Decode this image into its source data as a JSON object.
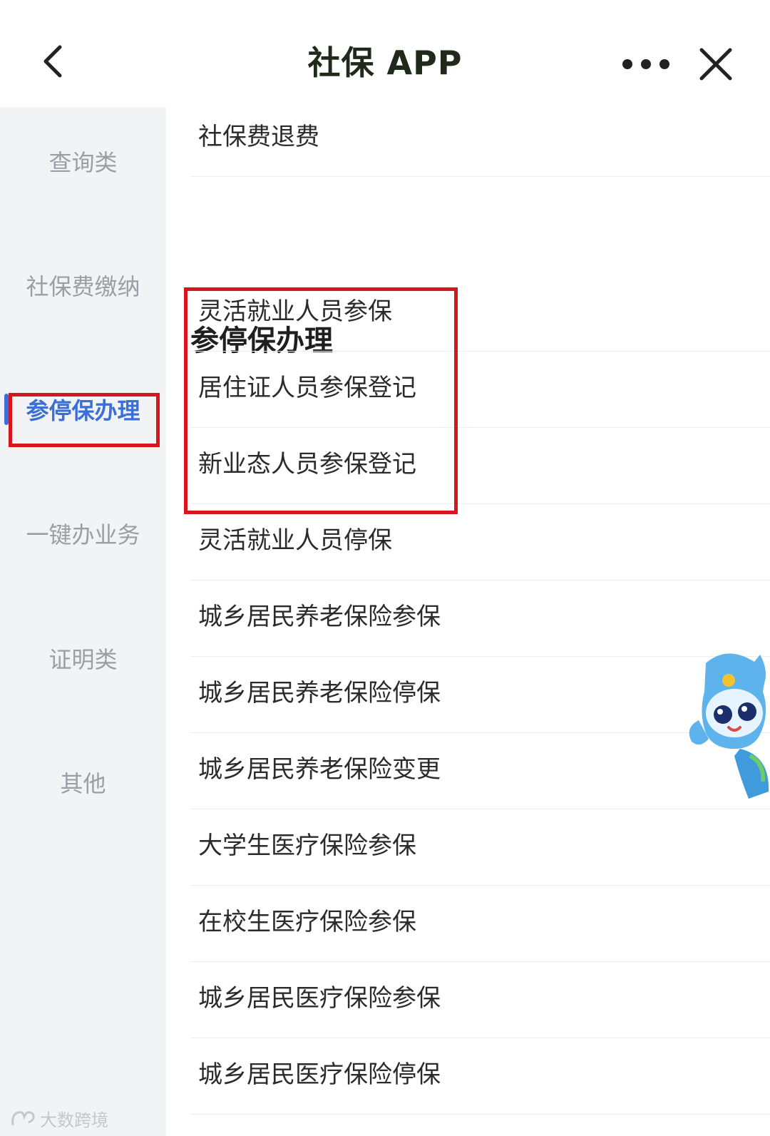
{
  "header": {
    "title": "社保 APP",
    "back_icon": "chevron-left-icon",
    "more_icon": "more-dots-icon",
    "close_icon": "close-icon"
  },
  "sidebar": {
    "items": [
      {
        "label": "查询类",
        "active": false
      },
      {
        "label": "社保费缴纳",
        "active": false
      },
      {
        "label": "参停保办理",
        "active": true
      },
      {
        "label": "一键办业务",
        "active": false
      },
      {
        "label": "证明类",
        "active": false
      },
      {
        "label": "其他",
        "active": false
      }
    ],
    "active_color": "#3b6fd8"
  },
  "main": {
    "top_item": "社保费退费",
    "section_title": "参停保办理",
    "items": [
      "灵活就业人员参保",
      "居住证人员参保登记",
      "新业态人员参保登记",
      "灵活就业人员停保",
      "城乡居民养老保险参保",
      "城乡居民养老保险停保",
      "城乡居民养老保险变更",
      "大学生医疗保险参保",
      "在校生医疗保险参保",
      "城乡居民医疗保险参保",
      "城乡居民医疗保险停保"
    ]
  },
  "highlight_color": "#d9141e",
  "watermark": {
    "text": "大数跨境"
  }
}
